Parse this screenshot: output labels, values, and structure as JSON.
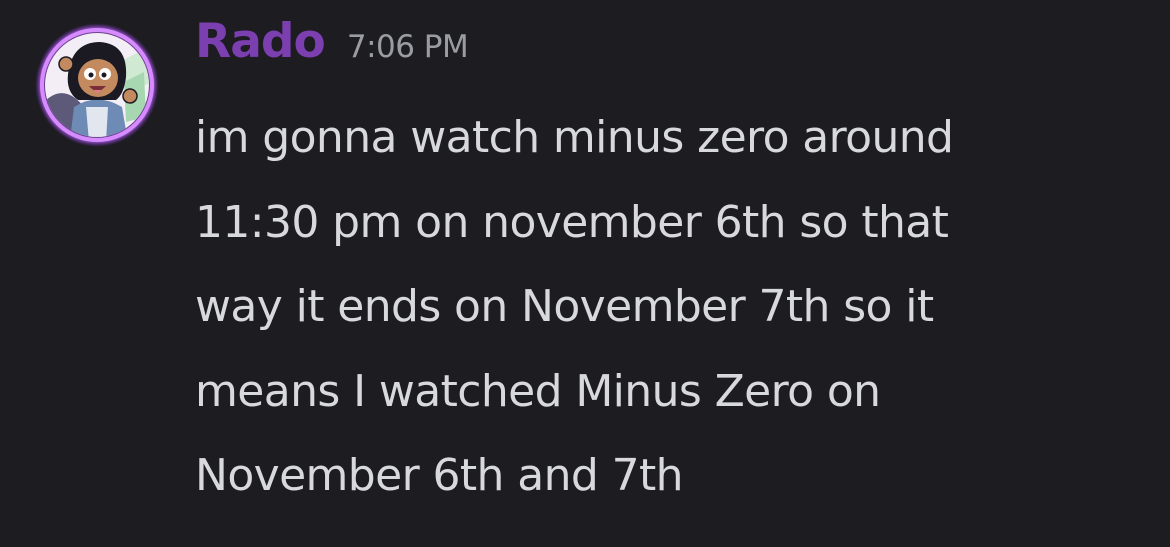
{
  "message": {
    "author": {
      "name": "Rado",
      "name_color": "#7b3fb0",
      "avatar": {
        "icon": "cartoon-avatar-icon",
        "ring_color": "#b257ff"
      }
    },
    "timestamp": "7:06 PM",
    "lines": [
      "im gonna watch minus zero around",
      "11:30 pm on november 6th so that",
      "way it ends on November 7th so it",
      "means I watched Minus Zero on",
      "November 6th and 7th"
    ]
  }
}
